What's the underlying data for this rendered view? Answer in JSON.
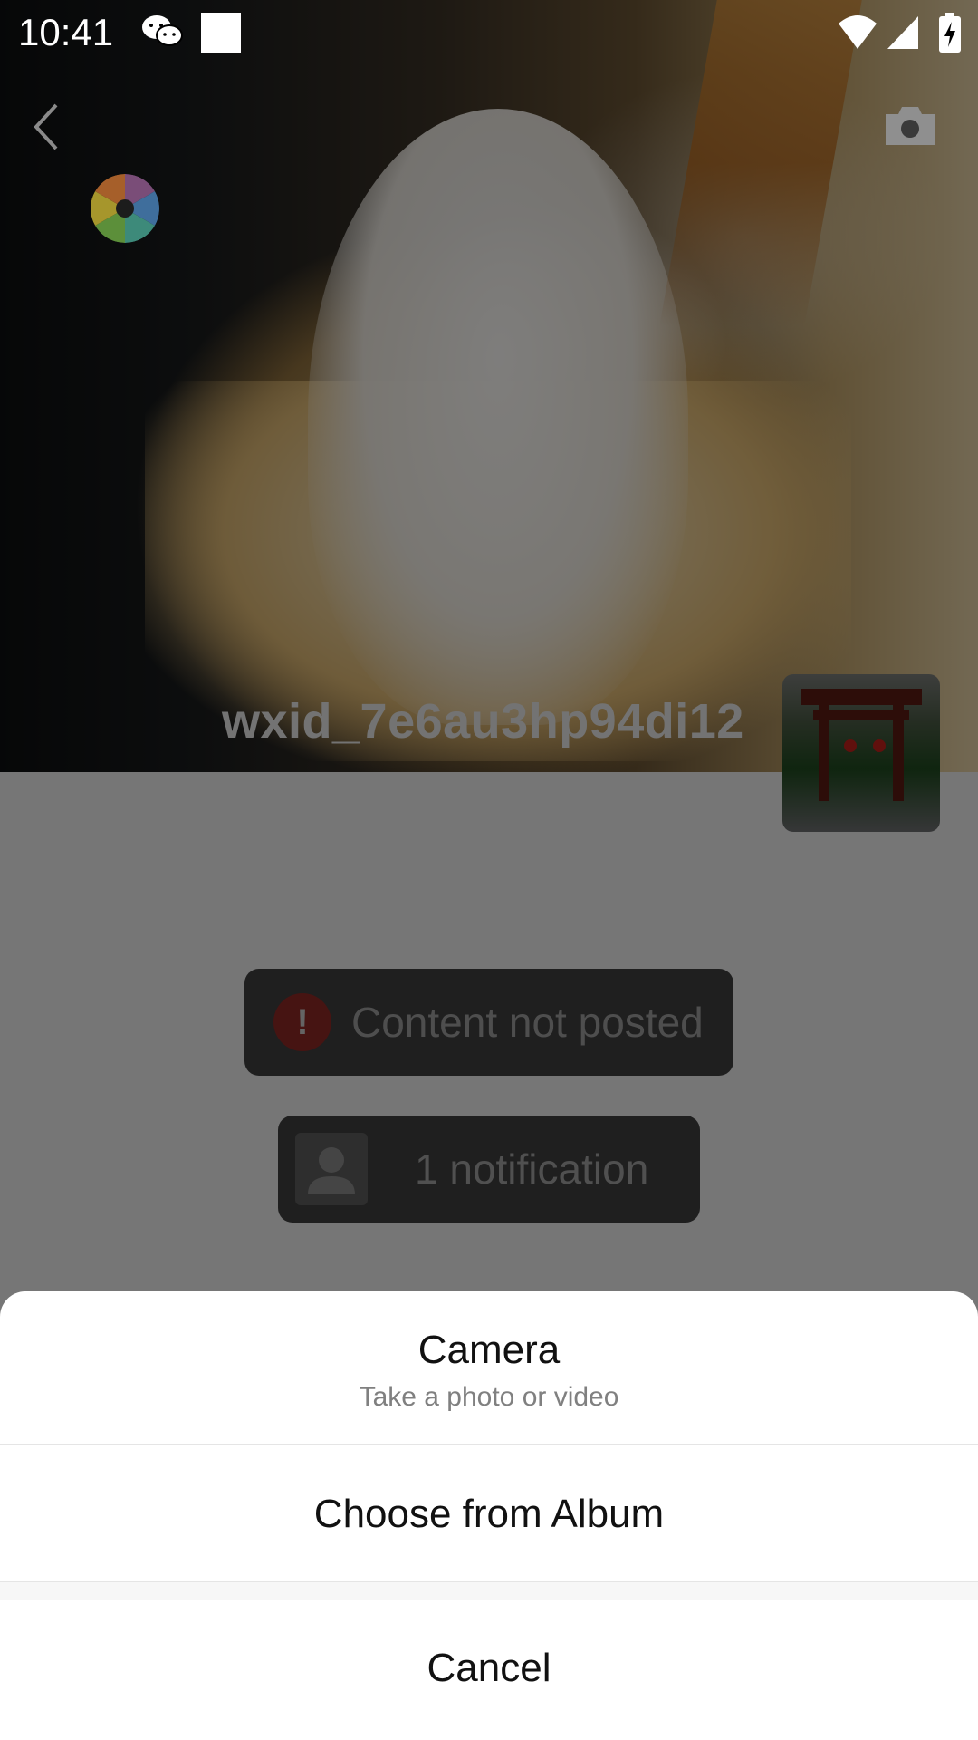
{
  "status_bar": {
    "time": "10:41",
    "icons": [
      "wechat-icon",
      "notification-square-icon",
      "wifi-icon",
      "signal-icon",
      "battery-charging-icon"
    ]
  },
  "header": {
    "back_icon": "chevron-left-icon",
    "camera_icon": "camera-icon",
    "aperture_icon": "aperture-icon"
  },
  "profile": {
    "username": "wxid_7e6au3hp94di12"
  },
  "toasts": {
    "error_text": "Content not posted",
    "error_icon": "exclamation-icon",
    "notification_text": "1 notification",
    "notification_icon": "person-icon"
  },
  "action_sheet": {
    "camera_title": "Camera",
    "camera_subtitle": "Take a photo or video",
    "album_title": "Choose from Album",
    "cancel_title": "Cancel"
  },
  "colors": {
    "error_red": "#8c2824",
    "sheet_bg": "#ffffff",
    "scrim": "rgba(0,0,0,0.5)"
  }
}
